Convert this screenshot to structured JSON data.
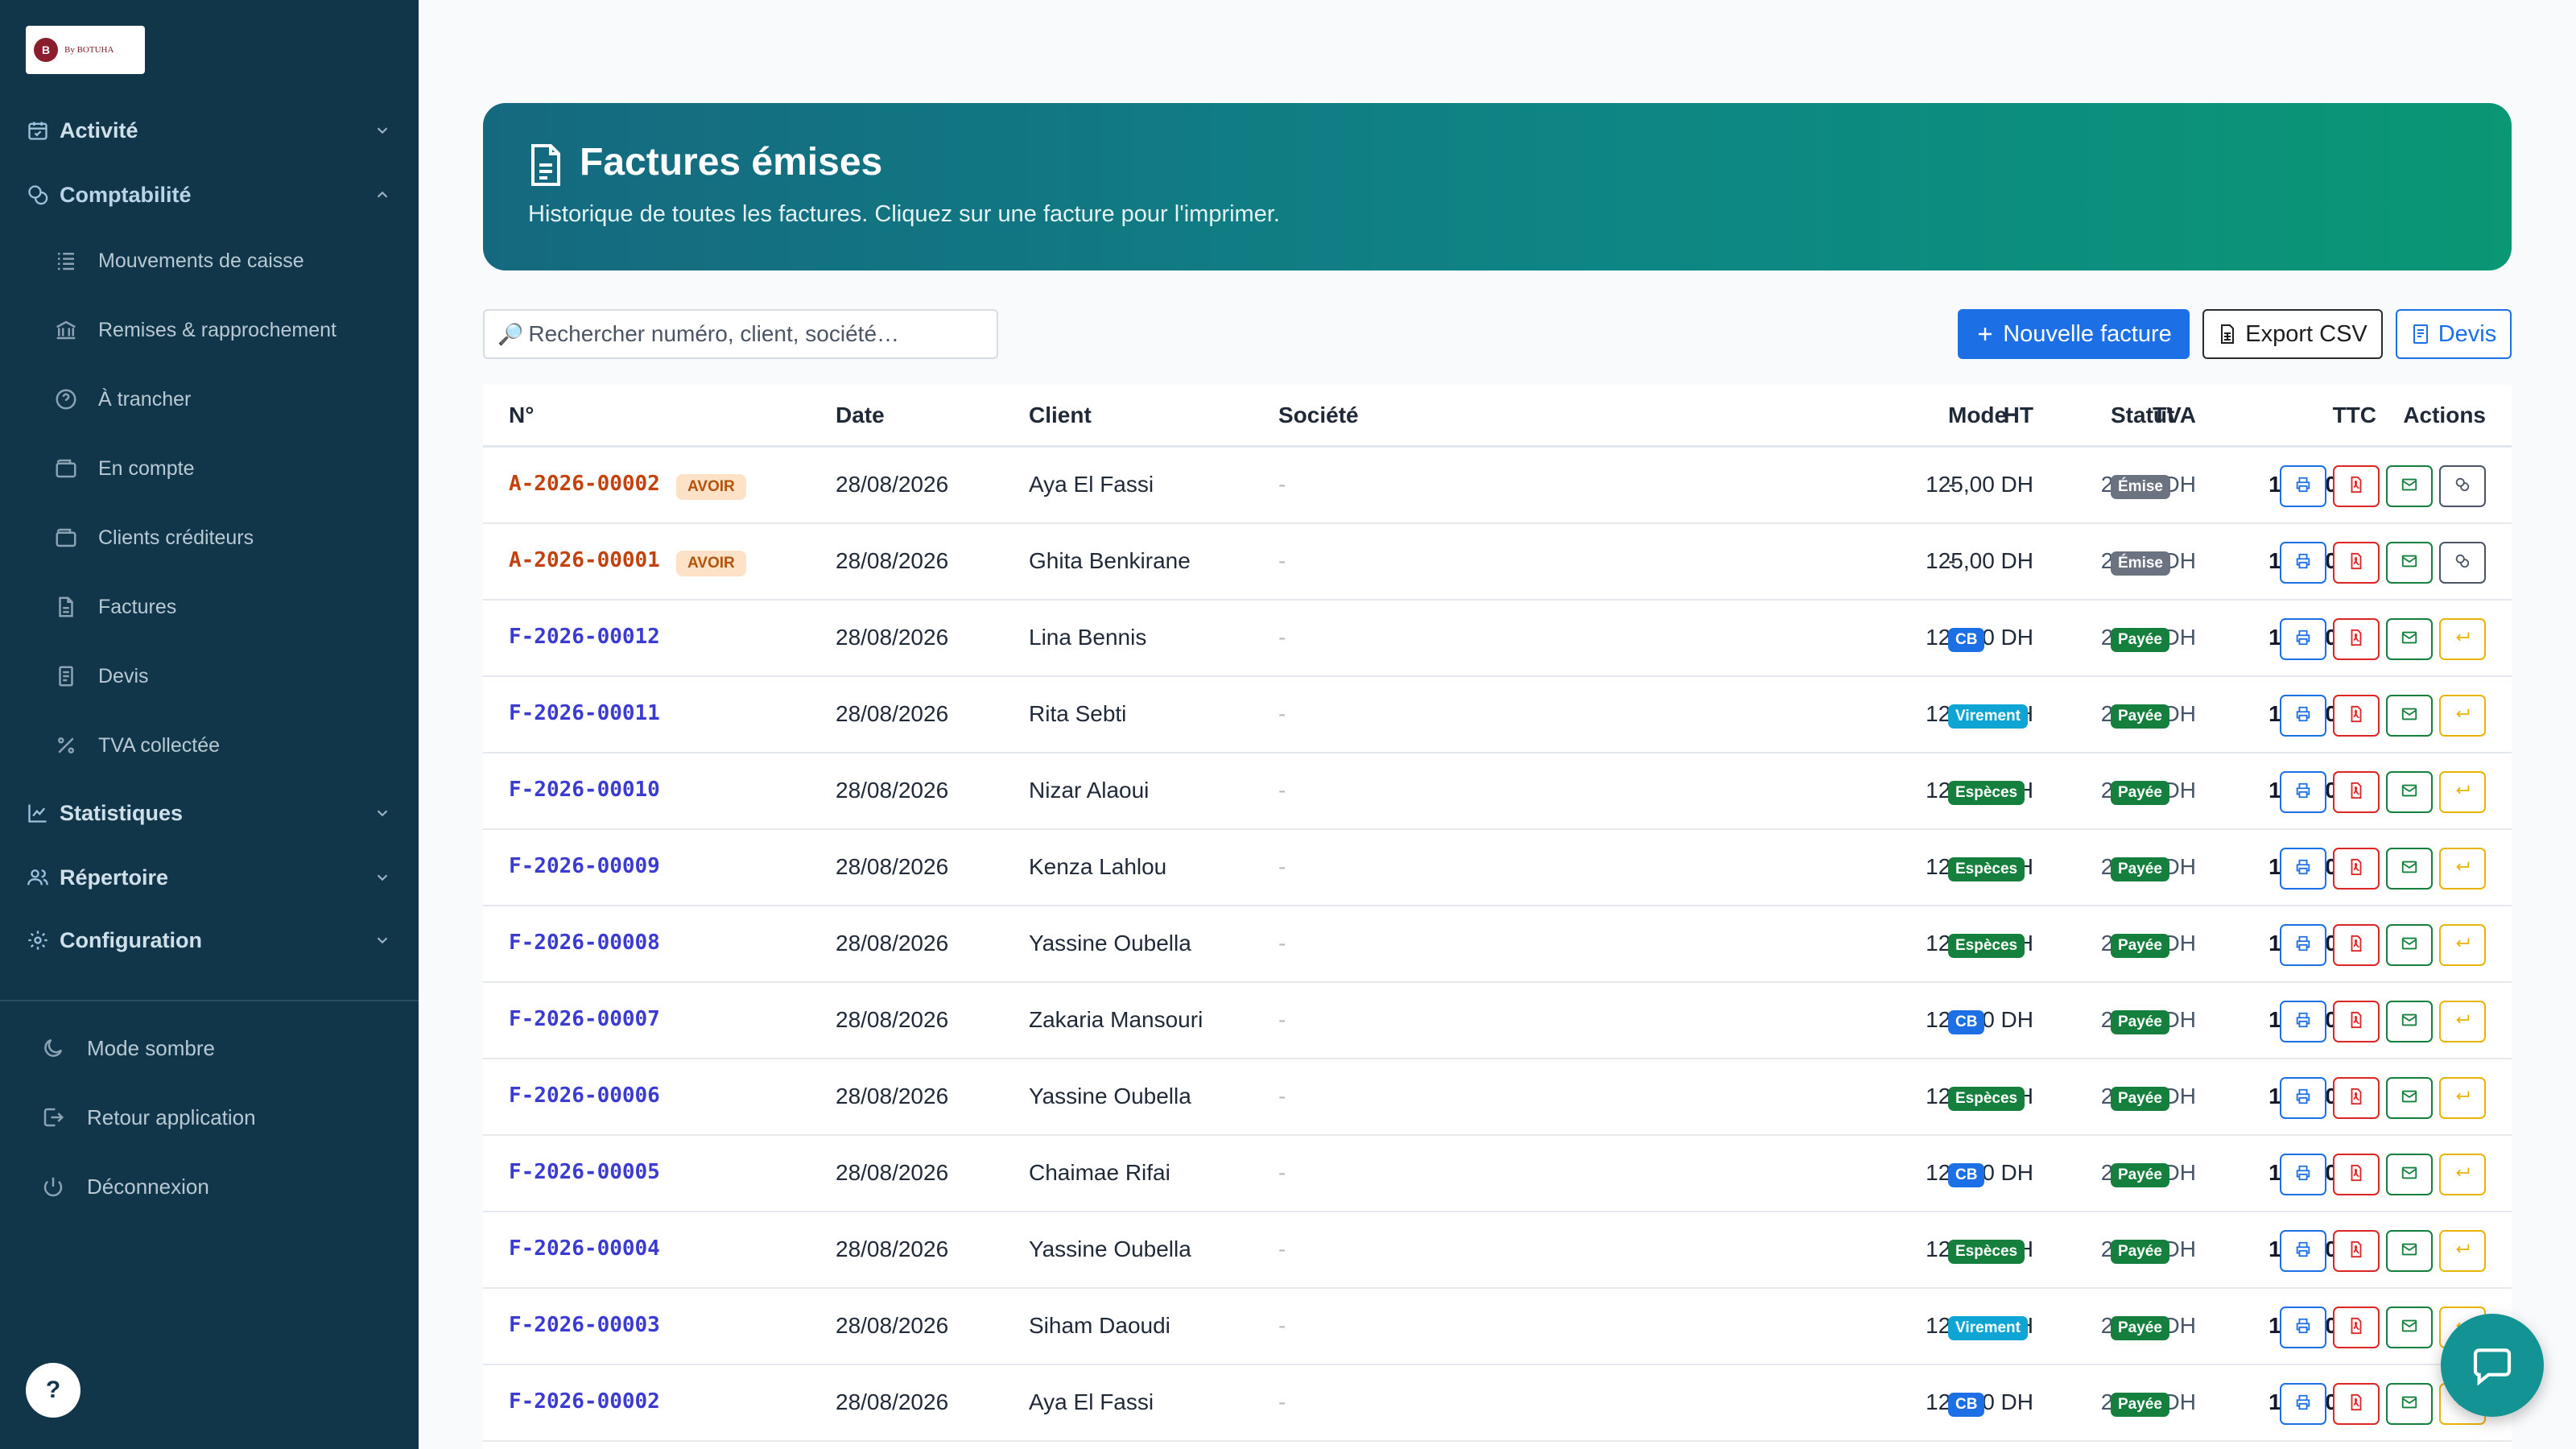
{
  "brand": {
    "logo_text": "By BOTUHA"
  },
  "sidebar": {
    "groups": [
      {
        "label": "Activité",
        "icon": "calendar-check-icon"
      },
      {
        "label": "Comptabilité",
        "icon": "coins-icon"
      },
      {
        "label": "Statistiques",
        "icon": "chart-line-icon"
      },
      {
        "label": "Répertoire",
        "icon": "users-icon"
      },
      {
        "label": "Configuration",
        "icon": "gear-icon"
      }
    ],
    "items": [
      {
        "label": "Mouvements de caisse",
        "icon": "list-icon"
      },
      {
        "label": "Remises & rapprochement",
        "icon": "bank-icon"
      },
      {
        "label": "À trancher",
        "icon": "question-circle-icon"
      },
      {
        "label": "En compte",
        "icon": "wallet-icon"
      },
      {
        "label": "Clients créditeurs",
        "icon": "wallet-icon"
      },
      {
        "label": "Factures",
        "icon": "file-icon"
      },
      {
        "label": "Devis",
        "icon": "file-text-icon"
      },
      {
        "label": "TVA collectée",
        "icon": "percent-icon"
      }
    ],
    "bottom": [
      {
        "label": "Mode sombre",
        "icon": "moon-icon"
      },
      {
        "label": "Retour application",
        "icon": "arrow-left-icon"
      },
      {
        "label": "Déconnexion",
        "icon": "power-icon"
      }
    ],
    "help_label": "?"
  },
  "hero": {
    "title": "Factures émises",
    "subtitle": "Historique de toutes les factures. Cliquez sur une facture pour l'imprimer."
  },
  "search": {
    "placeholder": "Rechercher numéro, client, société…",
    "icon": "🔎"
  },
  "toolbar": {
    "new_label": "Nouvelle facture",
    "csv_label": "Export CSV",
    "devis_label": "Devis"
  },
  "table": {
    "columns": {
      "num": "N°",
      "date": "Date",
      "client": "Client",
      "societe": "Société",
      "ht": "HT",
      "tva": "TVA",
      "ttc": "TTC",
      "mode": "Mode",
      "statut": "Statut",
      "actions": "Actions"
    },
    "rows": [
      {
        "num": "A-2026-00002",
        "tag": "AVOIR",
        "date": "28/08/2026",
        "client": "Aya El Fassi",
        "societe": "-",
        "ht": "125,00 DH",
        "tva": "25,00 DH",
        "ttc": "150,00 DH",
        "mode": "-",
        "statut": "Émise"
      },
      {
        "num": "A-2026-00001",
        "tag": "AVOIR",
        "date": "28/08/2026",
        "client": "Ghita Benkirane",
        "societe": "-",
        "ht": "125,00 DH",
        "tva": "25,00 DH",
        "ttc": "150,00 DH",
        "mode": "-",
        "statut": "Émise"
      },
      {
        "num": "F-2026-00012",
        "tag": "",
        "date": "28/08/2026",
        "client": "Lina Bennis",
        "societe": "-",
        "ht": "125,00 DH",
        "tva": "25,00 DH",
        "ttc": "150,00 DH",
        "mode": "CB",
        "statut": "Payée"
      },
      {
        "num": "F-2026-00011",
        "tag": "",
        "date": "28/08/2026",
        "client": "Rita Sebti",
        "societe": "-",
        "ht": "125,00 DH",
        "tva": "25,00 DH",
        "ttc": "150,00 DH",
        "mode": "Virement",
        "statut": "Payée"
      },
      {
        "num": "F-2026-00010",
        "tag": "",
        "date": "28/08/2026",
        "client": "Nizar Alaoui",
        "societe": "-",
        "ht": "125,00 DH",
        "tva": "25,00 DH",
        "ttc": "150,00 DH",
        "mode": "Espèces",
        "statut": "Payée"
      },
      {
        "num": "F-2026-00009",
        "tag": "",
        "date": "28/08/2026",
        "client": "Kenza Lahlou",
        "societe": "-",
        "ht": "125,00 DH",
        "tva": "25,00 DH",
        "ttc": "150,00 DH",
        "mode": "Espèces",
        "statut": "Payée"
      },
      {
        "num": "F-2026-00008",
        "tag": "",
        "date": "28/08/2026",
        "client": "Yassine Oubella",
        "societe": "-",
        "ht": "125,00 DH",
        "tva": "25,00 DH",
        "ttc": "150,00 DH",
        "mode": "Espèces",
        "statut": "Payée"
      },
      {
        "num": "F-2026-00007",
        "tag": "",
        "date": "28/08/2026",
        "client": "Zakaria Mansouri",
        "societe": "-",
        "ht": "125,00 DH",
        "tva": "25,00 DH",
        "ttc": "150,00 DH",
        "mode": "CB",
        "statut": "Payée"
      },
      {
        "num": "F-2026-00006",
        "tag": "",
        "date": "28/08/2026",
        "client": "Yassine Oubella",
        "societe": "-",
        "ht": "125,00 DH",
        "tva": "25,00 DH",
        "ttc": "150,00 DH",
        "mode": "Espèces",
        "statut": "Payée"
      },
      {
        "num": "F-2026-00005",
        "tag": "",
        "date": "28/08/2026",
        "client": "Chaimae Rifai",
        "societe": "-",
        "ht": "125,00 DH",
        "tva": "25,00 DH",
        "ttc": "150,00 DH",
        "mode": "CB",
        "statut": "Payée"
      },
      {
        "num": "F-2026-00004",
        "tag": "",
        "date": "28/08/2026",
        "client": "Yassine Oubella",
        "societe": "-",
        "ht": "125,00 DH",
        "tva": "25,00 DH",
        "ttc": "150,00 DH",
        "mode": "Espèces",
        "statut": "Payée"
      },
      {
        "num": "F-2026-00003",
        "tag": "",
        "date": "28/08/2026",
        "client": "Siham Daoudi",
        "societe": "-",
        "ht": "125,00 DH",
        "tva": "25,00 DH",
        "ttc": "150,00 DH",
        "mode": "Virement",
        "statut": "Payée"
      },
      {
        "num": "F-2026-00002",
        "tag": "",
        "date": "28/08/2026",
        "client": "Aya El Fassi",
        "societe": "-",
        "ht": "125,00 DH",
        "tva": "25,00 DH",
        "ttc": "150,00 DH",
        "mode": "CB",
        "statut": "Payée"
      }
    ]
  },
  "colors": {
    "sidebar": "#11364a",
    "primary": "#1d6fe6",
    "success": "#15803d",
    "avoir": "#c2410c",
    "facture": "#3b3bd1"
  }
}
